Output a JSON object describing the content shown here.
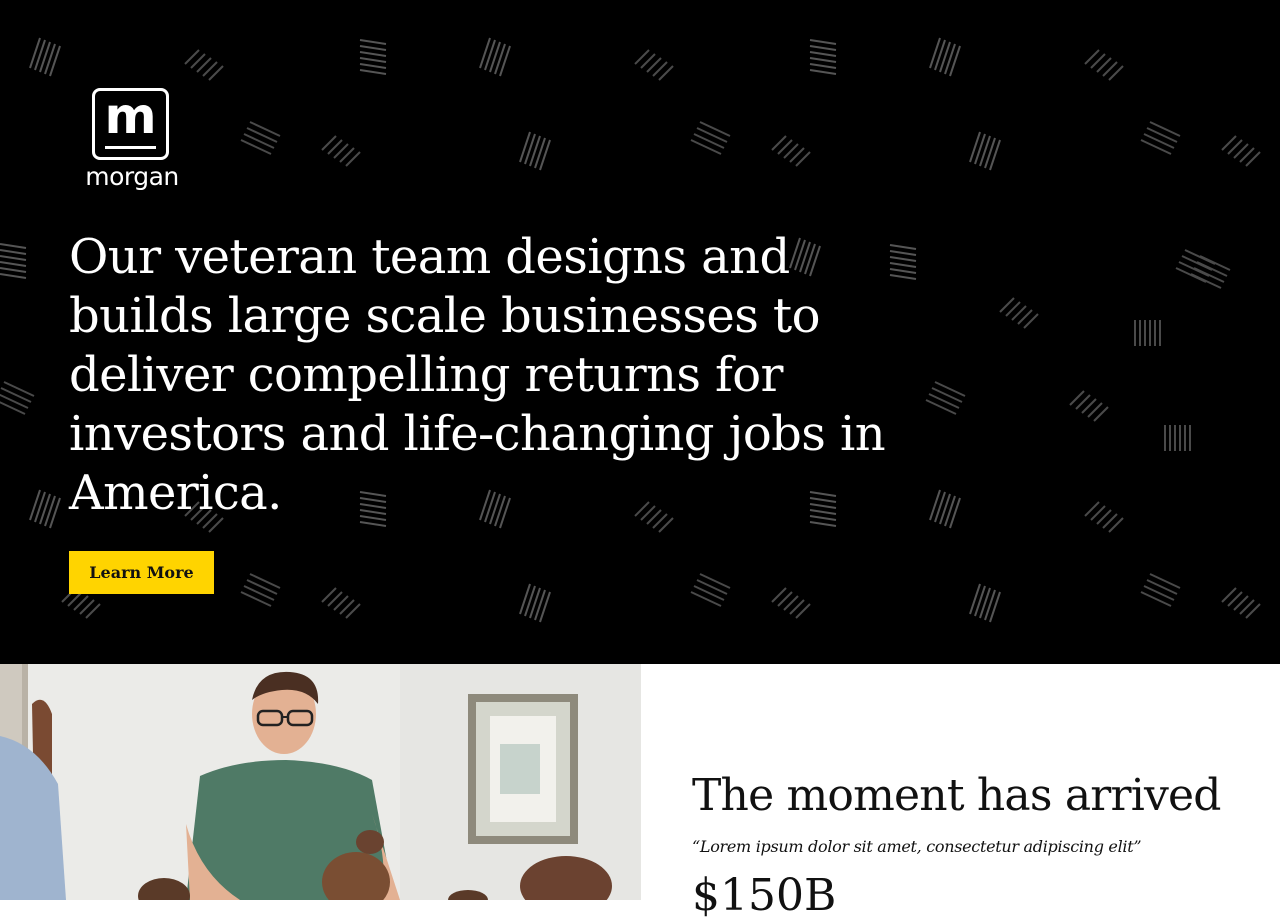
{
  "brand": {
    "logo_letter": "m",
    "logo_word": "morgan"
  },
  "hero": {
    "headline": "Our veteran team designs and builds large scale businesses to deliver compelling returns for investors and life-changing jobs in America.",
    "cta_label": "Learn More",
    "background_color": "#000000",
    "accent_color": "#ffd400"
  },
  "feature": {
    "title": "The moment has arrived",
    "quote": "“Lorem ipsum dolor sit amet, consectetur adipiscing elit”",
    "stat": "$150B"
  },
  "icons": {
    "logo": "morgan-logo-icon",
    "pattern": "stripe-pattern",
    "photo": "team-photo"
  }
}
